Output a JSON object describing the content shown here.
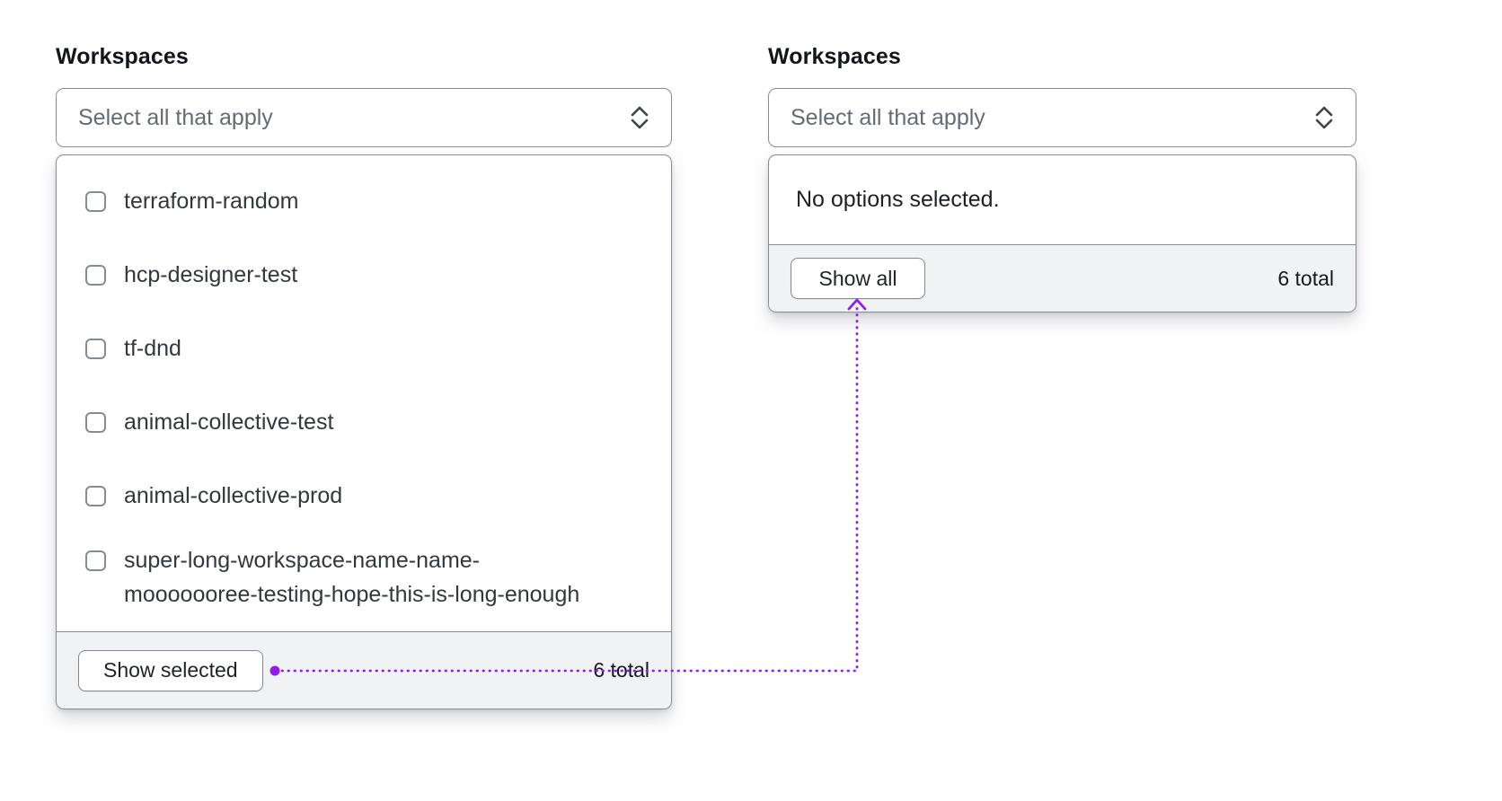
{
  "colors": {
    "annotation": "#911ced",
    "border": "#878b94",
    "footer_bg": "#f1f2f3"
  },
  "icons": {
    "trigger": "chevron-up-down-icon",
    "annotation_line": "dotted-arrow-connector"
  },
  "left_combobox": {
    "label": "Workspaces",
    "trigger_placeholder": "Select all that apply",
    "dropdown": {
      "options": [
        "terraform-random",
        "hcp-designer-test",
        "tf-dnd",
        "animal-collective-test",
        "animal-collective-prod",
        "super-long-workspace-name-name-mooooooree-testing-hope-this-is-long-enough"
      ],
      "footer": {
        "button": "Show selected",
        "total": "6 total"
      }
    }
  },
  "right_combobox": {
    "label": "Workspaces",
    "trigger_placeholder": "Select all that apply",
    "dropdown": {
      "empty_message": "No options selected.",
      "footer": {
        "button": "Show all",
        "total": "6 total"
      }
    }
  }
}
